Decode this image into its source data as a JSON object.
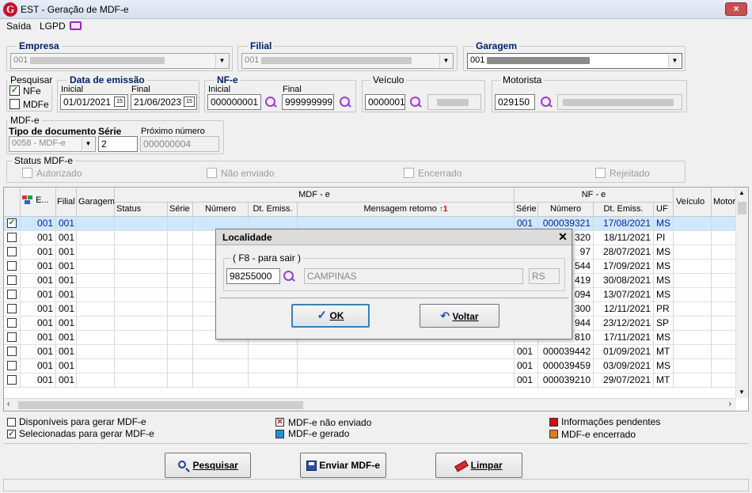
{
  "window": {
    "title": "EST - Geração de MDF-e",
    "close_label": "×"
  },
  "menu": {
    "items": [
      "Saída",
      "LGPD"
    ]
  },
  "empresa": {
    "label": "Empresa",
    "value": "001"
  },
  "filial": {
    "label": "Filial",
    "value": "001"
  },
  "garagem": {
    "label": "Garagem",
    "value": "001"
  },
  "pesquisar": {
    "label": "Pesquisar",
    "nfe": "NFe",
    "mdfe": "MDFe"
  },
  "data_emissao": {
    "label": "Data de emissão",
    "inicial_label": "Inicial",
    "final_label": "Final",
    "inicial": "01/01/2021",
    "final": "21/06/2023",
    "cal_icon": "15"
  },
  "nfe": {
    "label": "NF-e",
    "inicial_label": "Inicial",
    "final_label": "Final",
    "inicial": "000000001",
    "final": "999999999"
  },
  "veiculo": {
    "label": "Veículo",
    "value": "0000001"
  },
  "motorista": {
    "label": "Motorista",
    "value": "029150"
  },
  "mdfe_group": {
    "label": "MDF-e",
    "tipo_label": "Tipo de documento",
    "serie_label": "Série",
    "proximo_label": "Próximo número",
    "tipo": "0058 - MDF-e",
    "serie": "2",
    "proximo": "000000004"
  },
  "status_group": {
    "label": "Status MDF-e",
    "items": [
      "Autorizado",
      "Não enviado",
      "Encerrado",
      "Rejeitado"
    ]
  },
  "grid": {
    "group_headers": {
      "mdfe": "MDF - e",
      "nfe": "NF - e"
    },
    "headers": {
      "e": "E...",
      "filial": "Filial",
      "garagem": "Garagem",
      "status": "Status",
      "serie": "Série",
      "numero": "Número",
      "dt_emiss": "Dt. Emiss.",
      "mensagem": "Mensagem retorno",
      "sort_num": "1",
      "nf_serie": "Série",
      "nf_numero": "Número",
      "nf_dt": "Dt. Emiss.",
      "uf": "UF",
      "veiculo": "Veículo",
      "motorista": "Motori"
    },
    "rows": [
      {
        "checked": true,
        "e": "001",
        "filial": "001",
        "nf_serie": "001",
        "nf_numero": "000039321",
        "nf_dt": "17/08/2021",
        "uf": "MS"
      },
      {
        "checked": false,
        "e": "001",
        "filial": "001",
        "nf_serie": "",
        "nf_numero": "320",
        "nf_dt": "18/11/2021",
        "uf": "PI"
      },
      {
        "checked": false,
        "e": "001",
        "filial": "001",
        "nf_serie": "",
        "nf_numero": "97",
        "nf_dt": "28/07/2021",
        "uf": "MS"
      },
      {
        "checked": false,
        "e": "001",
        "filial": "001",
        "nf_serie": "",
        "nf_numero": "544",
        "nf_dt": "17/09/2021",
        "uf": "MS"
      },
      {
        "checked": false,
        "e": "001",
        "filial": "001",
        "nf_serie": "",
        "nf_numero": "419",
        "nf_dt": "30/08/2021",
        "uf": "MS"
      },
      {
        "checked": false,
        "e": "001",
        "filial": "001",
        "nf_serie": "",
        "nf_numero": "094",
        "nf_dt": "13/07/2021",
        "uf": "MS"
      },
      {
        "checked": false,
        "e": "001",
        "filial": "001",
        "nf_serie": "",
        "nf_numero": "300",
        "nf_dt": "12/11/2021",
        "uf": "PR"
      },
      {
        "checked": false,
        "e": "001",
        "filial": "001",
        "nf_serie": "",
        "nf_numero": "944",
        "nf_dt": "23/12/2021",
        "uf": "SP"
      },
      {
        "checked": false,
        "e": "001",
        "filial": "001",
        "nf_serie": "",
        "nf_numero": "810",
        "nf_dt": "17/11/2021",
        "uf": "MS"
      },
      {
        "checked": false,
        "e": "001",
        "filial": "001",
        "nf_serie": "001",
        "nf_numero": "000039442",
        "nf_dt": "01/09/2021",
        "uf": "MT"
      },
      {
        "checked": false,
        "e": "001",
        "filial": "001",
        "nf_serie": "001",
        "nf_numero": "000039459",
        "nf_dt": "03/09/2021",
        "uf": "MS"
      },
      {
        "checked": false,
        "e": "001",
        "filial": "001",
        "nf_serie": "001",
        "nf_numero": "000039210",
        "nf_dt": "29/07/2021",
        "uf": "MT"
      }
    ]
  },
  "legend": {
    "disponiveis": "Disponíveis para gerar MDF-e",
    "selecionadas": "Selecionadas para gerar MDF-e",
    "nao_enviado": "MDF-e não enviado",
    "gerado": "MDF-e gerado",
    "pendentes": "Informações pendentes",
    "encerrado": "MDF-e encerrado",
    "colors": {
      "nao_enviado": "#d02020",
      "gerado": "#1e90d6",
      "pendentes": "#d01010",
      "encerrado": "#e07b1a"
    }
  },
  "buttons": {
    "pesquisar": "Pesquisar",
    "enviar": "Enviar MDF-e",
    "limpar": "Limpar"
  },
  "dialog": {
    "title": "Localidade",
    "group_label": "( F8 - para sair )",
    "codigo": "98255000",
    "cidade": "CAMPINAS",
    "uf": "RS",
    "ok": "OK",
    "voltar": "Voltar"
  }
}
